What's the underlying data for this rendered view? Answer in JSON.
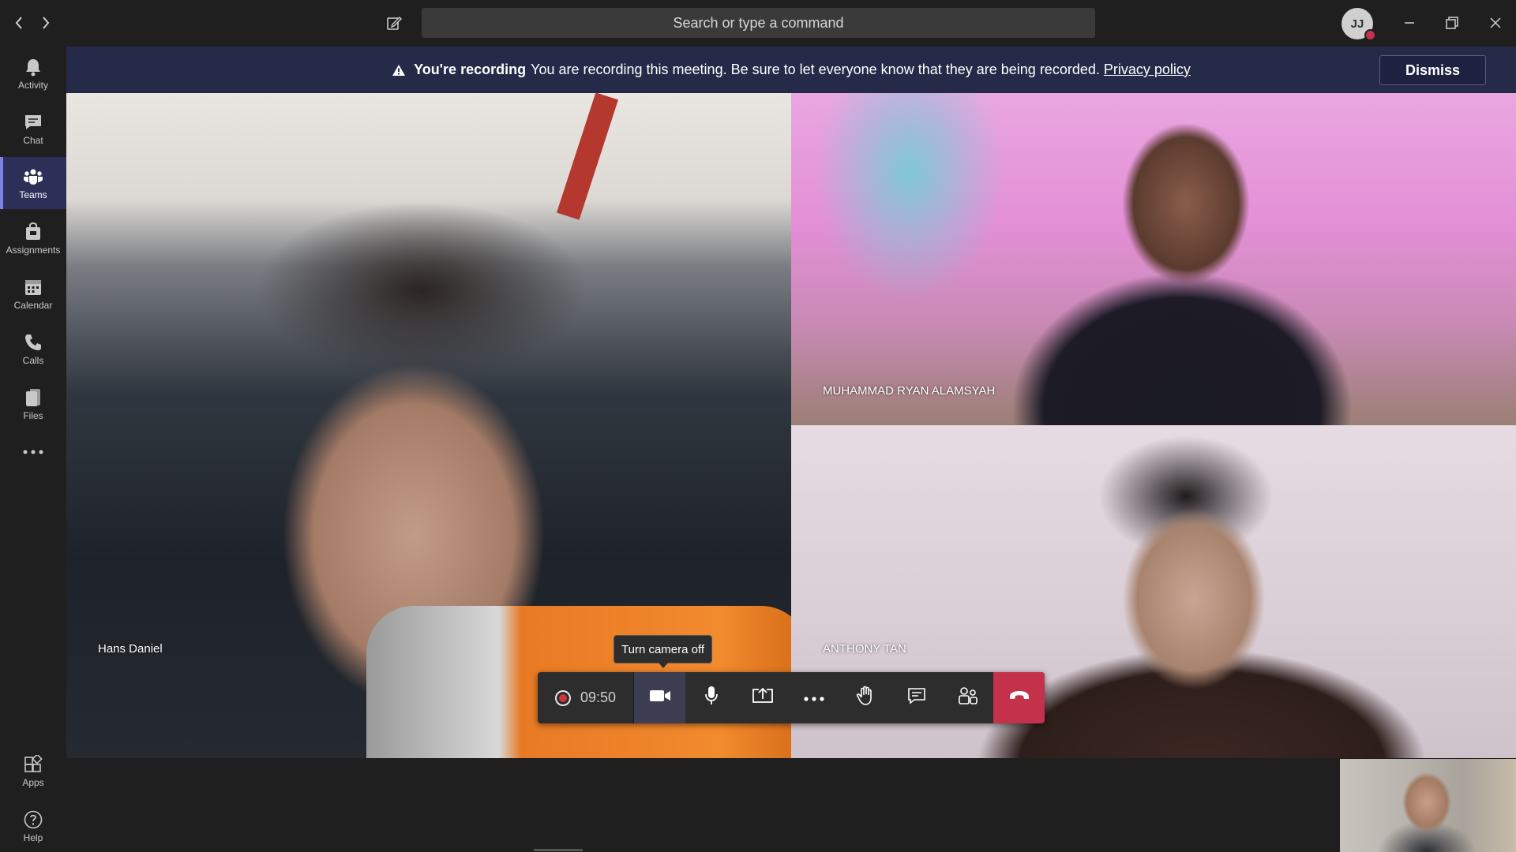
{
  "titlebar": {
    "search_placeholder": "Search or type a command",
    "avatar_initials": "JJ"
  },
  "rail": {
    "items": [
      {
        "label": "Activity",
        "icon": "bell-icon"
      },
      {
        "label": "Chat",
        "icon": "chat-icon"
      },
      {
        "label": "Teams",
        "icon": "teams-icon",
        "active": true
      },
      {
        "label": "Assignments",
        "icon": "assignments-icon"
      },
      {
        "label": "Calendar",
        "icon": "calendar-icon"
      },
      {
        "label": "Calls",
        "icon": "phone-icon"
      },
      {
        "label": "Files",
        "icon": "files-icon"
      }
    ],
    "apps_label": "Apps",
    "help_label": "Help"
  },
  "banner": {
    "title": "You're recording",
    "message": "You are recording this meeting. Be sure to let everyone know that they are being recorded.",
    "link": "Privacy policy",
    "dismiss_label": "Dismiss",
    "background_color": "#252a48"
  },
  "participants": [
    {
      "name": "Hans Daniel"
    },
    {
      "name": "MUHAMMAD RYAN ALAMSYAH"
    },
    {
      "name": "ANTHONY TAN"
    }
  ],
  "controls": {
    "timer": "09:50",
    "tooltip": "Turn camera off",
    "hangup_color": "#c4314b"
  }
}
